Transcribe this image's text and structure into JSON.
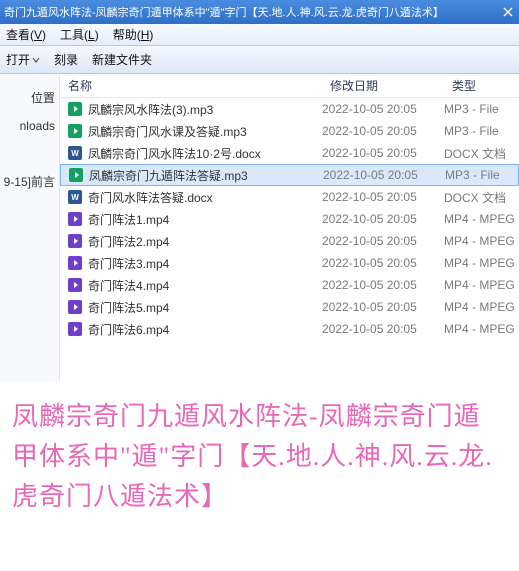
{
  "titlebar": {
    "text": "奇门九遁风水阵法-凤麟宗奇门遁甲体系中\"遁\"字门【天.地.人.神.风.云.龙.虎奇门八遁法术】"
  },
  "menubar": {
    "view": "查看",
    "view_key": "V",
    "tools": "工具",
    "tools_key": "L",
    "help": "帮助",
    "help_key": "H"
  },
  "toolbar": {
    "open": "打开",
    "burn": "刻录",
    "newfolder": "新建文件夹"
  },
  "sidebar": {
    "i0": "位置",
    "i1": "nloads",
    "i2": "9-15]前言"
  },
  "columns": {
    "name": "名称",
    "date": "修改日期",
    "type": "类型"
  },
  "files": [
    {
      "name": "凤麟宗风水阵法(3).mp3",
      "date": "2022-10-05 20:05",
      "type": "MP3 - File",
      "ext": "mp3",
      "sel": false
    },
    {
      "name": "凤麟宗奇门风水课及答疑.mp3",
      "date": "2022-10-05 20:05",
      "type": "MP3 - File",
      "ext": "mp3",
      "sel": false
    },
    {
      "name": "凤麟宗奇门风水阵法10·2号.docx",
      "date": "2022-10-05 20:05",
      "type": "DOCX 文档",
      "ext": "docx",
      "sel": false
    },
    {
      "name": "凤麟宗奇门九遁阵法答疑.mp3",
      "date": "2022-10-05 20:05",
      "type": "MP3 - File",
      "ext": "mp3",
      "sel": true
    },
    {
      "name": "奇门风水阵法答疑.docx",
      "date": "2022-10-05 20:05",
      "type": "DOCX 文档",
      "ext": "docx",
      "sel": false
    },
    {
      "name": "奇门阵法1.mp4",
      "date": "2022-10-05 20:05",
      "type": "MP4 - MPEG",
      "ext": "mp4",
      "sel": false
    },
    {
      "name": "奇门阵法2.mp4",
      "date": "2022-10-05 20:05",
      "type": "MP4 - MPEG",
      "ext": "mp4",
      "sel": false
    },
    {
      "name": "奇门阵法3.mp4",
      "date": "2022-10-05 20:05",
      "type": "MP4 - MPEG",
      "ext": "mp4",
      "sel": false
    },
    {
      "name": "奇门阵法4.mp4",
      "date": "2022-10-05 20:05",
      "type": "MP4 - MPEG",
      "ext": "mp4",
      "sel": false
    },
    {
      "name": "奇门阵法5.mp4",
      "date": "2022-10-05 20:05",
      "type": "MP4 - MPEG",
      "ext": "mp4",
      "sel": false
    },
    {
      "name": "奇门阵法6.mp4",
      "date": "2022-10-05 20:05",
      "type": "MP4 - MPEG",
      "ext": "mp4",
      "sel": false
    }
  ],
  "caption": "凤麟宗奇门九遁风水阵法-凤麟宗奇门遁甲体系中\"遁\"字门【天.地.人.神.风.云.龙.虎奇门八遁法术】"
}
